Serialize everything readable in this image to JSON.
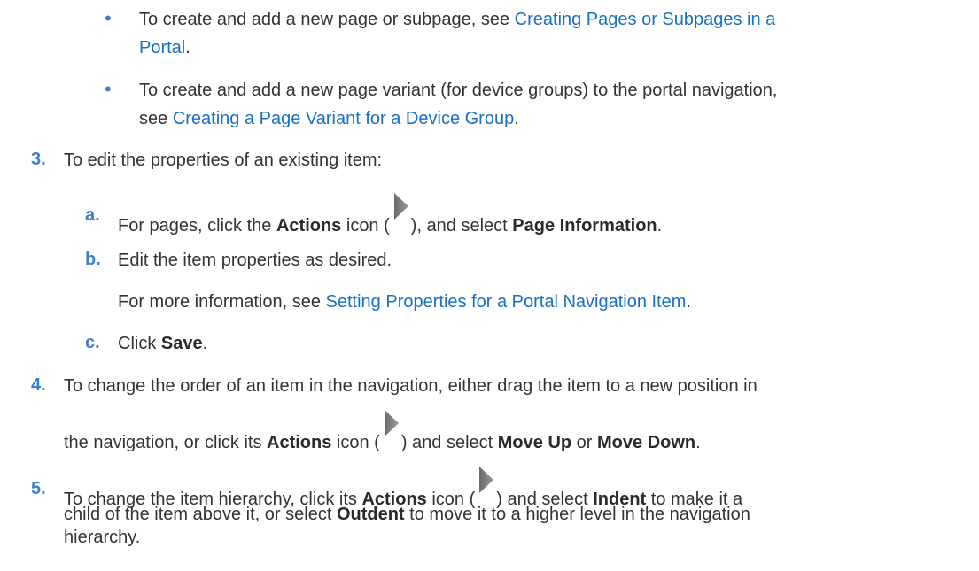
{
  "bullets": [
    {
      "marker": "•",
      "line1_text": "To create and add a new page or subpage, see ",
      "link_part1": "Creating Pages or Subpages in a",
      "link_part2": "Portal",
      "trail": "."
    },
    {
      "marker": "•",
      "line1_text": "To create and add a new page variant (for device groups) to the portal navigation,",
      "line2_text": "see ",
      "link": "Creating a Page Variant for a Device Group",
      "trail": "."
    }
  ],
  "step3": {
    "number": "3.",
    "text": "To edit the properties of an existing item:",
    "sub_a": {
      "marker": "a.",
      "t1": "For pages, click the ",
      "b1": "Actions",
      "t2": " icon (",
      "t3": "), and select ",
      "b2": "Page Information",
      "t4": "."
    },
    "sub_b": {
      "marker": "b.",
      "text": "Edit the item properties as desired.",
      "more_prefix": "For more information, see ",
      "link": "Setting Properties for a Portal Navigation Item",
      "trail": "."
    },
    "sub_c": {
      "marker": "c.",
      "t1": "Click ",
      "b1": "Save",
      "t2": "."
    }
  },
  "step4": {
    "number": "4.",
    "line1": "To change the order of an item in the navigation, either drag the item to a new position in",
    "t1": "the navigation, or click its ",
    "b1": "Actions",
    "t2": " icon (",
    "t3": ") and select ",
    "b2": "Move Up",
    "t4": " or ",
    "b3": "Move Down",
    "t5": "."
  },
  "step5": {
    "number": "5.",
    "t1": "To change the item hierarchy, click its ",
    "b1": "Actions",
    "t2": " icon (",
    "t3": ") and select ",
    "b2": "Indent",
    "t4": " to make it a",
    "line2": "child of the item above it, or select ",
    "b3": "Outdent",
    "line2_end": " to move it to a higher level in the navigation",
    "line3": "hierarchy."
  },
  "icons": {
    "actions": "actions-icon"
  },
  "colors": {
    "link": "#1a6fc4",
    "marker": "#3f7fc9",
    "text": "#333333"
  }
}
